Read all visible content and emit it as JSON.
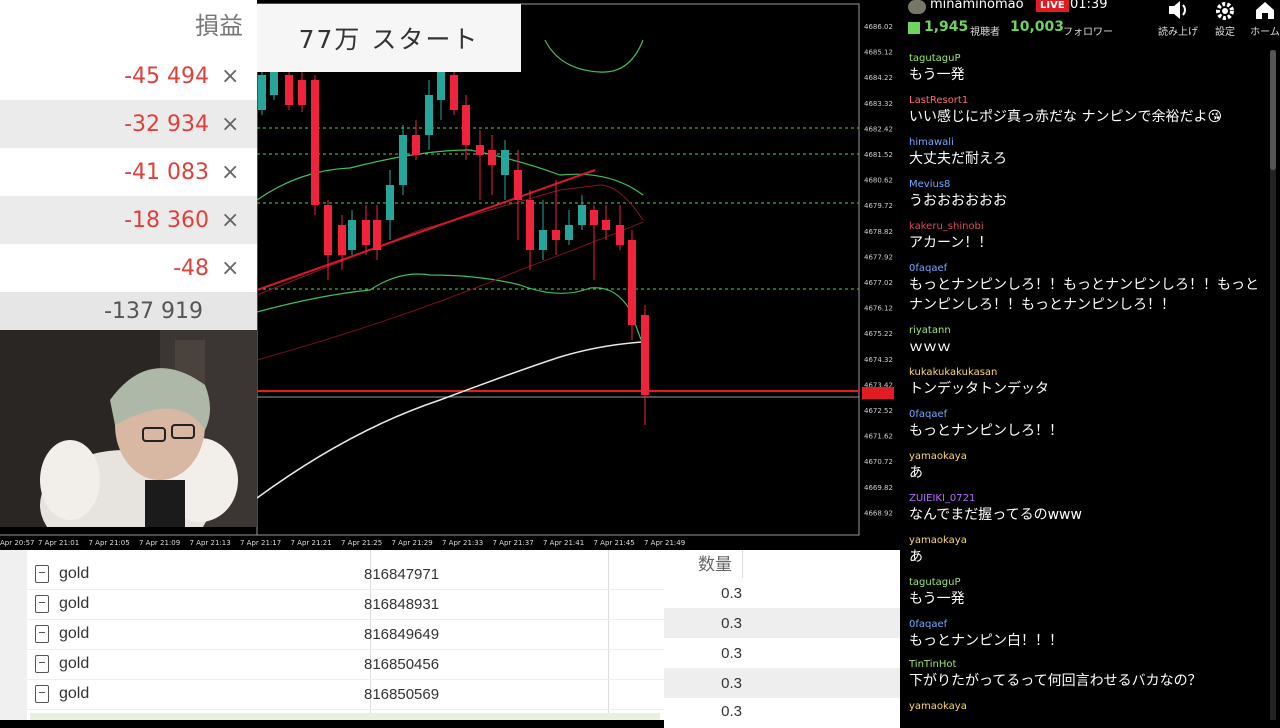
{
  "pl_panel": {
    "header": "損益",
    "rows": [
      {
        "value": "-45 494",
        "close": "×"
      },
      {
        "value": "-32 934",
        "close": "×"
      },
      {
        "value": "-41 083",
        "close": "×"
      },
      {
        "value": "-18 360",
        "close": "×"
      },
      {
        "value": "-48",
        "close": "×"
      }
    ],
    "total": "-137 919"
  },
  "note": "77万 スタート",
  "chart": {
    "price_levels": [
      "4686.02",
      "4685.12",
      "4684.22",
      "4683.32",
      "4682.42",
      "4681.52",
      "4680.62",
      "4679.72",
      "4678.82",
      "4677.92",
      "4677.02",
      "4676.12",
      "4675.22",
      "4674.32",
      "4673.42",
      "4672.52",
      "4671.62",
      "4670.72",
      "4669.82",
      "4668.92"
    ],
    "time_labels": [
      "Apr 20:57",
      "7 Apr 21:01",
      "7 Apr 21:05",
      "7 Apr 21:09",
      "7 Apr 21:13",
      "7 Apr 21:17",
      "7 Apr 21:21",
      "7 Apr 21:25",
      "7 Apr 21:29",
      "7 Apr 21:33",
      "7 Apr 21:37",
      "7 Apr 21:41",
      "7 Apr 21:45",
      "7 Apr 21:49"
    ],
    "colors": {
      "bull": "#26a69a",
      "bear": "#ef233c",
      "band": "#3fbf5a",
      "ma": "#e8e8e8",
      "trend": "#d11a2a"
    }
  },
  "positions": {
    "rows": [
      {
        "symbol": "gold",
        "ticket": "816847971"
      },
      {
        "symbol": "gold",
        "ticket": "816848931"
      },
      {
        "symbol": "gold",
        "ticket": "816849649"
      },
      {
        "symbol": "gold",
        "ticket": "816850456"
      },
      {
        "symbol": "gold",
        "ticket": "816850569"
      }
    ],
    "qty_header": "数量",
    "quantities": [
      "0.3",
      "0.3",
      "0.3",
      "0.3",
      "0.3"
    ]
  },
  "chat": {
    "header": {
      "username": "minaminomao",
      "live": "LIVE",
      "time": "01:39",
      "viewers": "1,945",
      "viewers_label": "視聴者",
      "followers": "10,003",
      "followers_label": "フォロワー",
      "buttons": [
        "読み上げ",
        "設定",
        "ホーム"
      ]
    },
    "messages": [
      {
        "user": "tagutaguP",
        "color": "#9fe86f",
        "text": "もう一発"
      },
      {
        "user": "LastResort1",
        "color": "#ff6b7a",
        "text": "いい感じにポジ真っ赤だな ナンピンで余裕だよ😘"
      },
      {
        "user": "himawali",
        "color": "#6fa8ff",
        "text": "大丈夫だ耐えろ"
      },
      {
        "user": "Mevius8",
        "color": "#6fa8ff",
        "text": "うおおおおおお"
      },
      {
        "user": "kakeru_shinobi",
        "color": "#d94a5c",
        "text": "アカーン！！"
      },
      {
        "user": "0faqaef",
        "color": "#6fa8ff",
        "text": "もっとナンピンしろ！！もっとナンピンしろ！！もっとナンピンしろ！！もっとナンピンしろ！！"
      },
      {
        "user": "riyatann",
        "color": "#9fe86f",
        "text": "ｗｗｗ"
      },
      {
        "user": "kukakukakukasan",
        "color": "#ffd86b",
        "text": "トンデッタトンデッタ"
      },
      {
        "user": "0faqaef",
        "color": "#6fa8ff",
        "text": "もっとナンピンしろ！！"
      },
      {
        "user": "yamaokaya",
        "color": "#ffd86b",
        "text": "あ"
      },
      {
        "user": "ZUIEIKI_0721",
        "color": "#b46bff",
        "text": "なんでまだ握ってるのwww"
      },
      {
        "user": "yamaokaya",
        "color": "#ffd86b",
        "text": "あ"
      },
      {
        "user": "tagutaguP",
        "color": "#9fe86f",
        "text": "もう一発"
      },
      {
        "user": "0faqaef",
        "color": "#6fa8ff",
        "text": "もっとナンピン白！！！"
      },
      {
        "user": "TinTinHot",
        "color": "#9fe86f",
        "text": "下がりたがってるって何回言わせるバカなの？"
      },
      {
        "user": "yamaokaya",
        "color": "#ffd86b",
        "text": ""
      }
    ]
  }
}
